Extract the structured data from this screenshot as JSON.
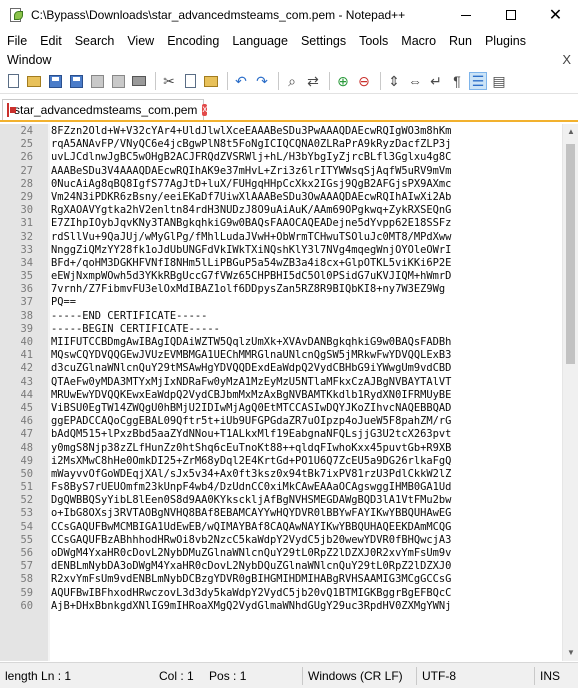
{
  "window": {
    "title": "C:\\Bypass\\Downloads\\star_advancedmsteams_com.pem - Notepad++",
    "minimize_label": "",
    "close_label": "✕"
  },
  "menu": {
    "row1": [
      "File",
      "Edit",
      "Search",
      "View",
      "Encoding",
      "Language",
      "Settings",
      "Tools",
      "Macro",
      "Run",
      "Plugins"
    ],
    "row2": [
      "Window"
    ],
    "close_x": "X"
  },
  "tab": {
    "label": "star_advancedmsteams_com.pem",
    "close": "x"
  },
  "editor": {
    "lines": [
      {
        "n": "24",
        "t": "8FZzn2Old+W+V32cYAr4+UldJlwlXceEAAABeSDu3PwAAAQDAEcwRQIgWO3m8hKm"
      },
      {
        "n": "25",
        "t": "rqA5ANAvFP/VNyQC6e4jcBgwPlN8t5FoNgICIQCQNA0ZLRaPrA9kRyzDacfZLP3j"
      },
      {
        "n": "26",
        "t": "uvLJCdlnwJgBC5wOHgB2ACJFRQdZVSRWlj+hL/H3bYbgIyZjrcBLfl3Gglxu4g8C"
      },
      {
        "n": "27",
        "t": "AAABeSDu3V4AAAQDAEcwRQIhAK9e37mHvL+Zri3z6lrITYWWsqSjAqfW5uRV9mVm"
      },
      {
        "n": "28",
        "t": "0NucAiAg8qBQ8IgfS77AgJtD+luX/FUHgqHHpCcXkx2IGsj9QgB2AFGjsPX9AXmc"
      },
      {
        "n": "29",
        "t": "Vm24N3iPDKR6zBsny/eeiEKaDf7UiwXlAAABeSDu3OwAAAQDAEcwRQIhAIwXi2Ab"
      },
      {
        "n": "30",
        "t": "RgXAOAVYgtka2hV2enltn84rdH3NUDzJ8O9uAiAuK/AAm69OPgkwq+ZykRXSEQnG"
      },
      {
        "n": "31",
        "t": "E7ZIhpIOybJqvKNy3TANBgkqhkiG9w0BAQsFAAOCAQEADejne5dYvpp62E18SSFz"
      },
      {
        "n": "32",
        "t": "rdSllVu+9QaJUj/wMyGlPg/fMhlLudaJVwH+ObWrmTCHwuTSOluJc0MT8/MPdXww"
      },
      {
        "n": "33",
        "t": "NnggZiQMzYY28fk1oJdUbUNGFdVkIWkTXiNQshKlY3l7NVg4mqegWnjOYOleOWrI"
      },
      {
        "n": "34",
        "t": "BFd+/qoHM3DGKHFVNfI8NHm5lLiPBGuP5a54wZB3a4i8cx+GlpOTKL5viKKi6P2E"
      },
      {
        "n": "35",
        "t": "eEWjNxmpWOwh5d3YKkRBgUccG7fVWz65CHPBHI5dC5Ol0PSidG7uKVJIQM+hWmrD"
      },
      {
        "n": "36",
        "t": "7vrnh/Z7FibmvFU3elOxMdIBAZ1olf6DDpysZan5RZ8R9BIQbKI8+ny7W3EZ9Wg"
      },
      {
        "n": "37",
        "t": "PQ=="
      },
      {
        "n": "38",
        "t": "-----END CERTIFICATE-----"
      },
      {
        "n": "39",
        "t": "-----BEGIN CERTIFICATE-----"
      },
      {
        "n": "40",
        "t": "MIIFUTCCBDmgAwIBAgIQDAiWZTW5QqlzUmXk+XVAvDANBgkqhkiG9w0BAQsFADBh"
      },
      {
        "n": "41",
        "t": "MQswCQYDVQQGEwJVUzEVMBMGA1UEChMMRGlnaUNlcnQgSW5jMRkwFwYDVQQLExB3"
      },
      {
        "n": "42",
        "t": "d3cuZGlnaWNlcnQuY29tMSAwHgYDVQQDExdEaWdpQ2VydCBHbG9iYWwgUm9vdCBD"
      },
      {
        "n": "43",
        "t": "QTAeFw0yMDA3MTYxMjIxNDRaFw0yMzA1MzEyMzU5NTlaMFkxCzAJBgNVBAYTAlVT"
      },
      {
        "n": "44",
        "t": "MRUwEwYDVQQKEwxEaWdpQ2VydCBJbmMxMzAxBgNVBAMTKkdlb1RydXN0IFRMUyBE"
      },
      {
        "n": "45",
        "t": "ViBSU0EgTW14ZWQgU0hBMjU2IDIwMjAgQ0EtMTCCASIwDQYJKoZIhvcNAQEBBQAD"
      },
      {
        "n": "46",
        "t": "ggEPADCCAQoCggEBAL09Qftr5t+iUb9UFGPGdaZR7uOIpzp4oJueW5F8pahZM/rG"
      },
      {
        "n": "47",
        "t": "bAdQM515+lPxzBbd5aaZYdNNou+T1ALkxMlf19EabgnaNFQLsjjG3U2tcX263pvt"
      },
      {
        "n": "48",
        "t": "y0mgS8Njp38zZLfHunZz0htShq6cEuTnoKt88++qldqFIwhoKxx45puvtGb+R9XB"
      },
      {
        "n": "49",
        "t": "i2MsXMwC8hHe0OmkDI25+ZrM68yDql2E4KrtGd+PO1U6Q7ZcEU5a9DG26rlkaFgQ"
      },
      {
        "n": "50",
        "t": "mWayvvOfGoWDEqjXAl/sJx5v34+Ax0ft3ksz0x94tBk7ixPV81rzU3PdlCkkW2lZ"
      },
      {
        "n": "51",
        "t": "Fs8ByS7rUEUOmfm23kUnpF4wb4/DzUdnCC0xiMkCAwEAAaOCAgswggIHMB0GA1Ud"
      },
      {
        "n": "52",
        "t": "DgQWBBQSyYibL8lEen0S8d9AA0KYksckljAfBgNVHSMEGDAWgBQD3lA1VtFMu2bw"
      },
      {
        "n": "53",
        "t": "o+IbG8OXsj3RVTAOBgNVHQ8BAf8EBAMCAYYwHQYDVR0lBBYwFAYIKwYBBQUHAwEG"
      },
      {
        "n": "54",
        "t": "CCsGAQUFBwMCMBIGA1UdEwEB/wQIMAYBAf8CAQAwNAYIKwYBBQUHAQEEKDAmMCQG"
      },
      {
        "n": "55",
        "t": "CCsGAQUFBzABhhhodHRwOi8vb2NzcC5kaWdpY2VydC5jb20wewYDVR0fBHQwcjA3"
      },
      {
        "n": "56",
        "t": "oDWgM4YxaHR0cDovL2NybDMuZGlnaWNlcnQuY29tL0RpZ2lDZXJ0R2xvYmFsUm9v"
      },
      {
        "n": "57",
        "t": "dENBLmNybDA3oDWgM4YxaHR0cDovL2NybDQuZGlnaWNlcnQuY29tL0RpZ2lDZXJ0"
      },
      {
        "n": "58",
        "t": "R2xvYmFsUm9vdENBLmNybDCBzgYDVR0gBIHGMIHDMIHABgRVHSAAMIG3MCgGCCsG"
      },
      {
        "n": "59",
        "t": "AQUFBwIBFhxodHRwczovL3d3dy5kaWdpY2VydC5jb20vQ1BTMIGKBggrBgEFBQcC"
      },
      {
        "n": "60",
        "t": "AjB+DHxBbnkgdXNlIG9mIHRoaXMgQ2VydGlmaWNhdGUgY29uc3RpdHV0ZXMgYWNj"
      }
    ]
  },
  "status": {
    "length": "length Ln : 1",
    "col": "Col : 1",
    "pos": "Pos : 1",
    "eol": "Windows (CR LF)",
    "encoding": "UTF-8",
    "mode": "INS"
  }
}
